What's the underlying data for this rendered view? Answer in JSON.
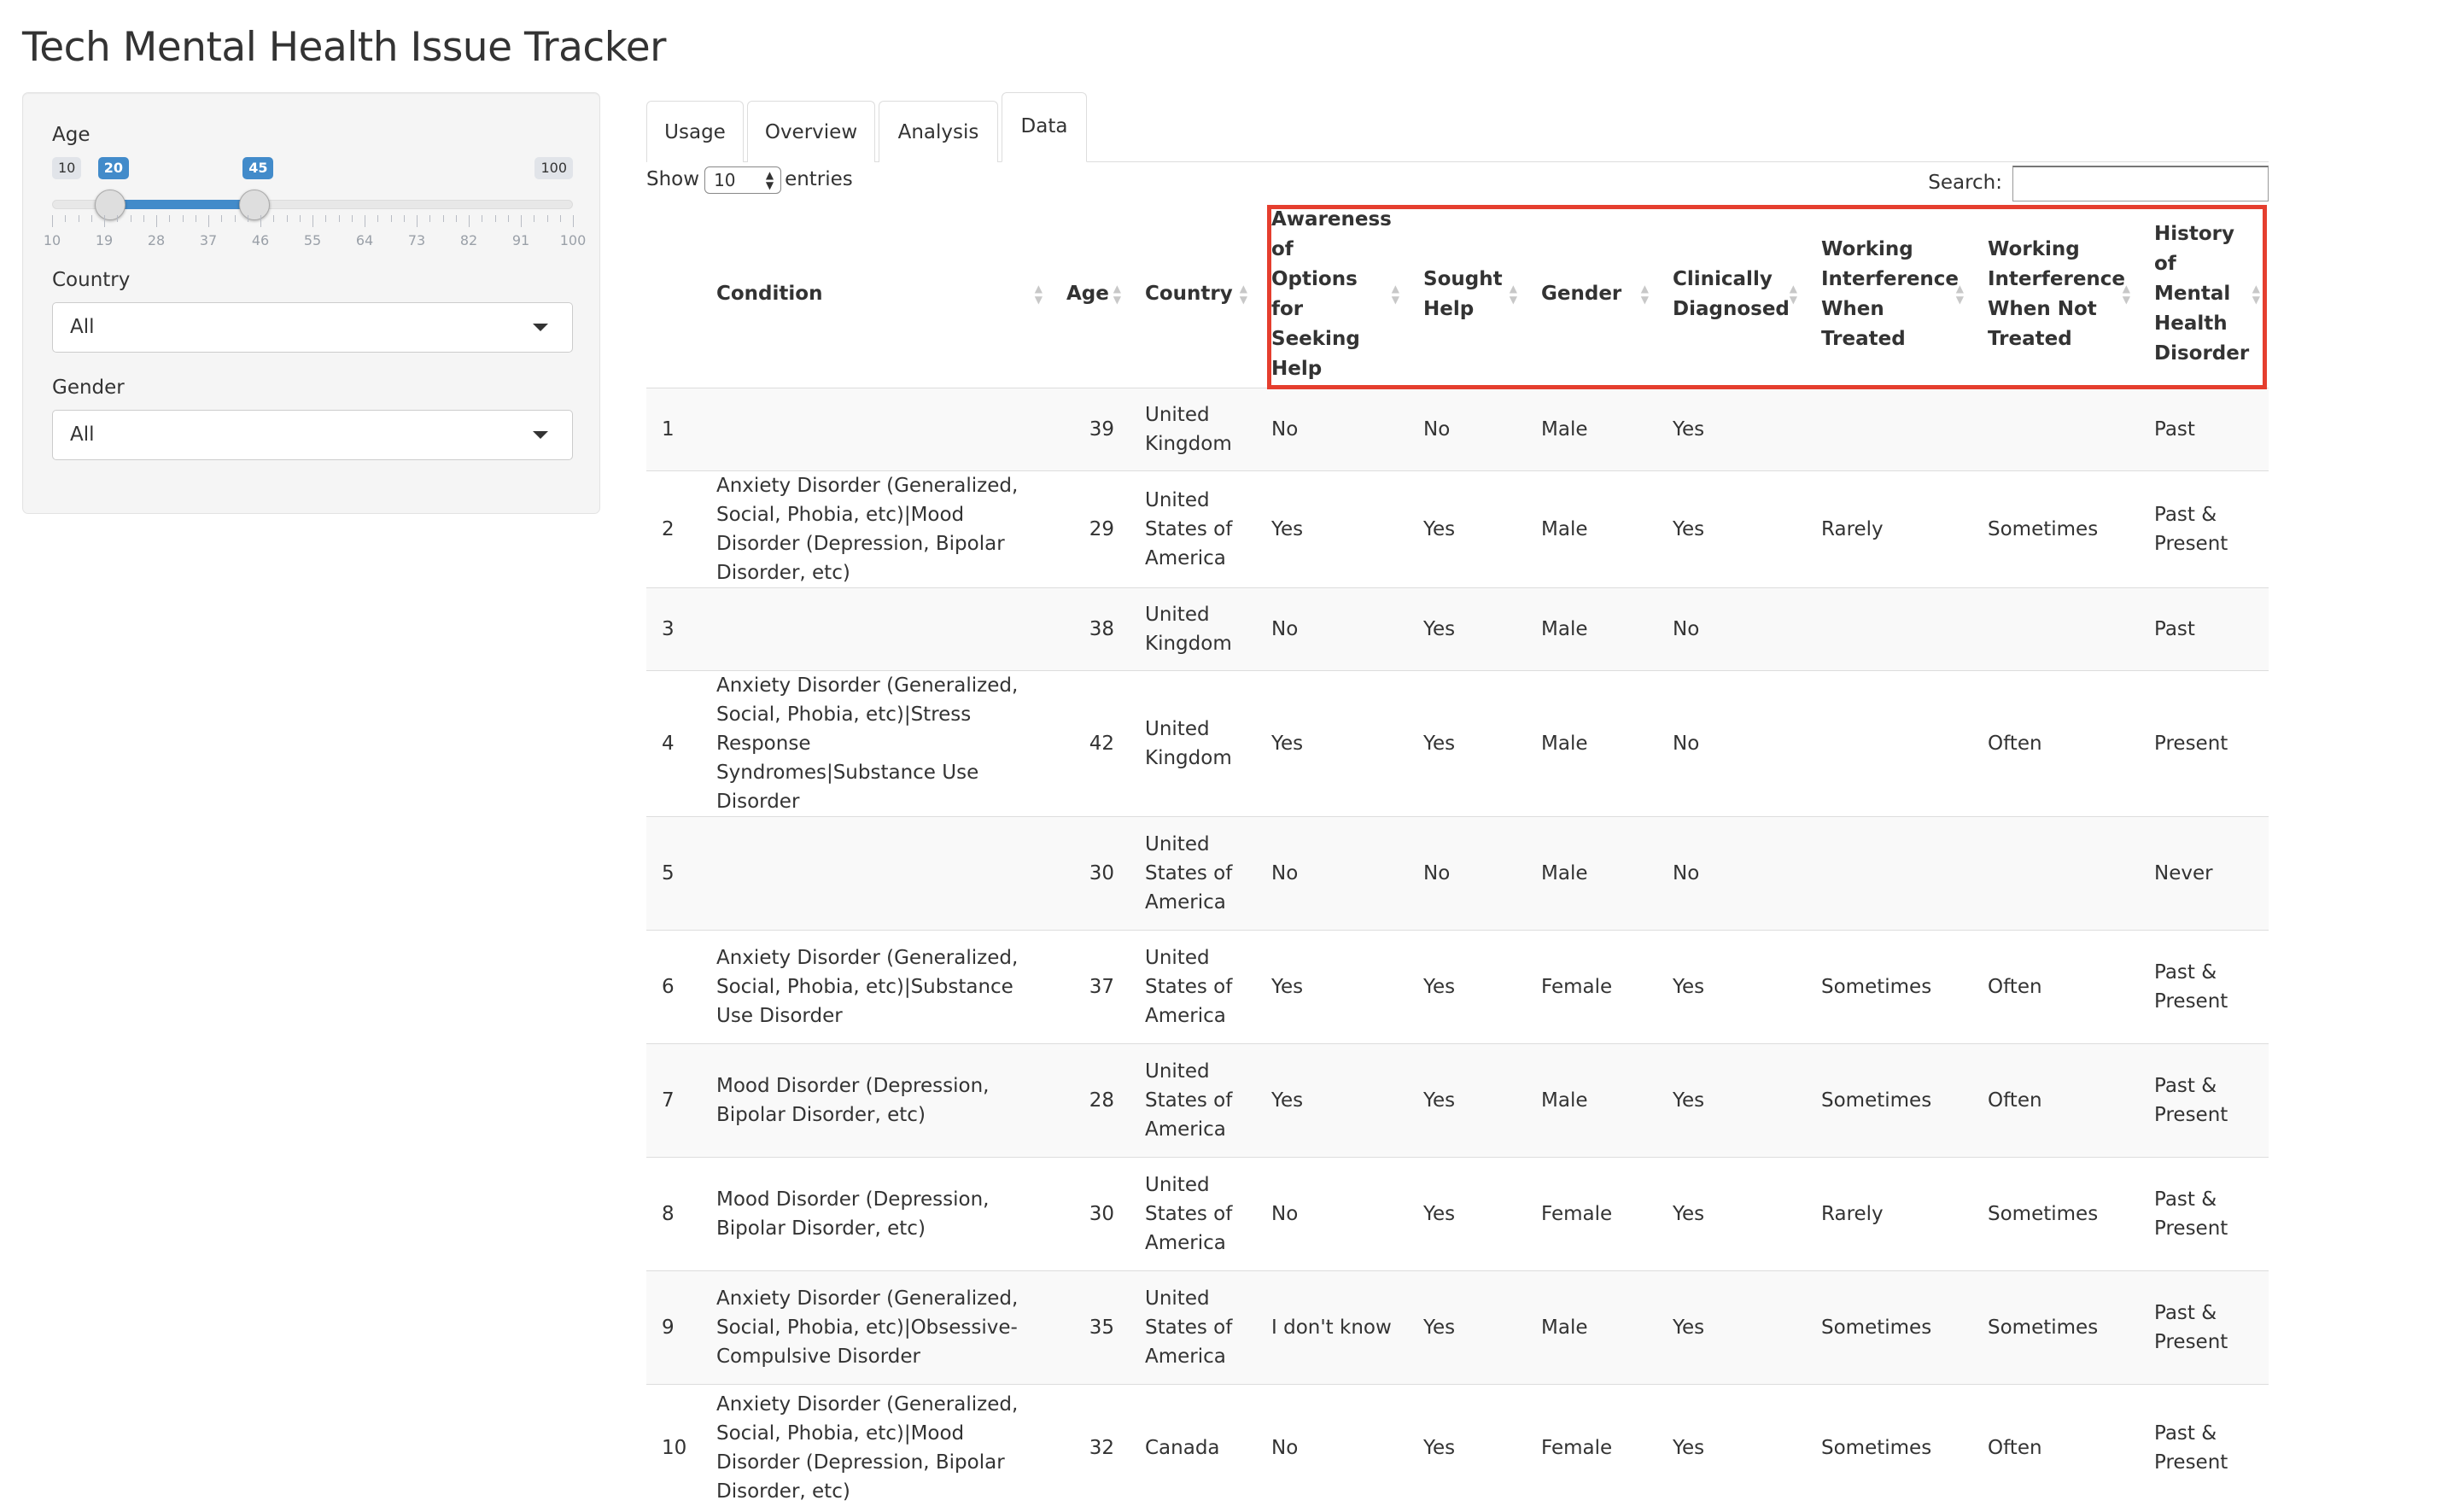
{
  "title": "Tech Mental Health Issue Tracker",
  "sidebar": {
    "age": {
      "label": "Age",
      "min": 10,
      "max": 100,
      "from": 20,
      "to": 45,
      "min_label": "10",
      "max_label": "100",
      "from_label": "20",
      "to_label": "45",
      "ticks": [
        "10",
        "19",
        "28",
        "37",
        "46",
        "55",
        "64",
        "73",
        "82",
        "91",
        "100"
      ]
    },
    "country": {
      "label": "Country",
      "value": "All"
    },
    "gender": {
      "label": "Gender",
      "value": "All"
    }
  },
  "tabs": [
    {
      "label": "Usage",
      "active": false
    },
    {
      "label": "Overview",
      "active": false
    },
    {
      "label": "Analysis",
      "active": false
    },
    {
      "label": "Data",
      "active": true
    }
  ],
  "table_controls": {
    "show_label": "Show",
    "page_length": "10",
    "entries_label": "entries",
    "search_label": "Search:",
    "search_value": ""
  },
  "table": {
    "columns": [
      "",
      "Condition",
      "Age",
      "Country",
      "Awareness of Options for Seeking Help",
      "Sought Help",
      "Gender",
      "Clinically Diagnosed",
      "Working Interference When Treated",
      "Working Interference When Not Treated",
      "History of Mental Health Disorder"
    ],
    "rows": [
      [
        "1",
        "",
        "39",
        "United Kingdom",
        "No",
        "No",
        "Male",
        "Yes",
        "",
        "",
        "Past"
      ],
      [
        "2",
        "Anxiety Disorder (Generalized, Social, Phobia, etc)|Mood Disorder (Depression, Bipolar Disorder, etc)",
        "29",
        "United States of America",
        "Yes",
        "Yes",
        "Male",
        "Yes",
        "Rarely",
        "Sometimes",
        "Past & Present"
      ],
      [
        "3",
        "",
        "38",
        "United Kingdom",
        "No",
        "Yes",
        "Male",
        "No",
        "",
        "",
        "Past"
      ],
      [
        "4",
        "Anxiety Disorder (Generalized, Social, Phobia, etc)|Stress Response Syndromes|Substance Use Disorder",
        "42",
        "United Kingdom",
        "Yes",
        "Yes",
        "Male",
        "No",
        "",
        "Often",
        "Present"
      ],
      [
        "5",
        "",
        "30",
        "United States of America",
        "No",
        "No",
        "Male",
        "No",
        "",
        "",
        "Never"
      ],
      [
        "6",
        "Anxiety Disorder (Generalized, Social, Phobia, etc)|Substance Use Disorder",
        "37",
        "United States of America",
        "Yes",
        "Yes",
        "Female",
        "Yes",
        "Sometimes",
        "Often",
        "Past & Present"
      ],
      [
        "7",
        "Mood Disorder (Depression, Bipolar Disorder, etc)",
        "28",
        "United States of America",
        "Yes",
        "Yes",
        "Male",
        "Yes",
        "Sometimes",
        "Often",
        "Past & Present"
      ],
      [
        "8",
        "Mood Disorder (Depression, Bipolar Disorder, etc)",
        "30",
        "United States of America",
        "No",
        "Yes",
        "Female",
        "Yes",
        "Rarely",
        "Sometimes",
        "Past & Present"
      ],
      [
        "9",
        "Anxiety Disorder (Generalized, Social, Phobia, etc)|Obsessive-Compulsive Disorder",
        "35",
        "United States of America",
        "I don't know",
        "Yes",
        "Male",
        "Yes",
        "Sometimes",
        "Sometimes",
        "Past & Present"
      ],
      [
        "10",
        "Anxiety Disorder (Generalized, Social, Phobia, etc)|Mood Disorder (Depression, Bipolar Disorder, etc)",
        "32",
        "Canada",
        "No",
        "Yes",
        "Female",
        "Yes",
        "Sometimes",
        "Often",
        "Past & Present"
      ]
    ]
  },
  "colors": {
    "accent": "#428bca",
    "highlight_border": "#e53e2e",
    "stripe": "#f9f9f9"
  }
}
